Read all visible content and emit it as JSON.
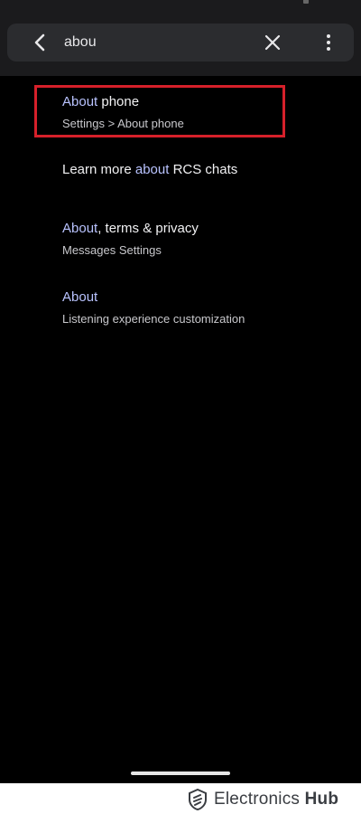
{
  "search": {
    "value": "abou",
    "back_icon": "chevron-left-icon",
    "clear_icon": "close-icon",
    "more_icon": "more-vert-icon"
  },
  "results": [
    {
      "title_hl": "About",
      "title_rest": " phone",
      "subtitle": "Settings > About phone"
    },
    {
      "title_pre": "Learn more ",
      "title_hl": "about",
      "title_rest": " RCS chats"
    },
    {
      "title_hl": "About",
      "title_rest": ", terms & privacy",
      "subtitle": "Messages Settings"
    },
    {
      "title_hl": "About",
      "title_rest": "",
      "subtitle": "Listening experience customization"
    }
  ],
  "watermark": {
    "brand_regular": "Electronics",
    "brand_bold": "Hub"
  },
  "colors": {
    "background": "#000000",
    "search_bar": "#2b2c2f",
    "highlight_text": "#b9c3ff",
    "annotation_box": "#d6202a"
  }
}
